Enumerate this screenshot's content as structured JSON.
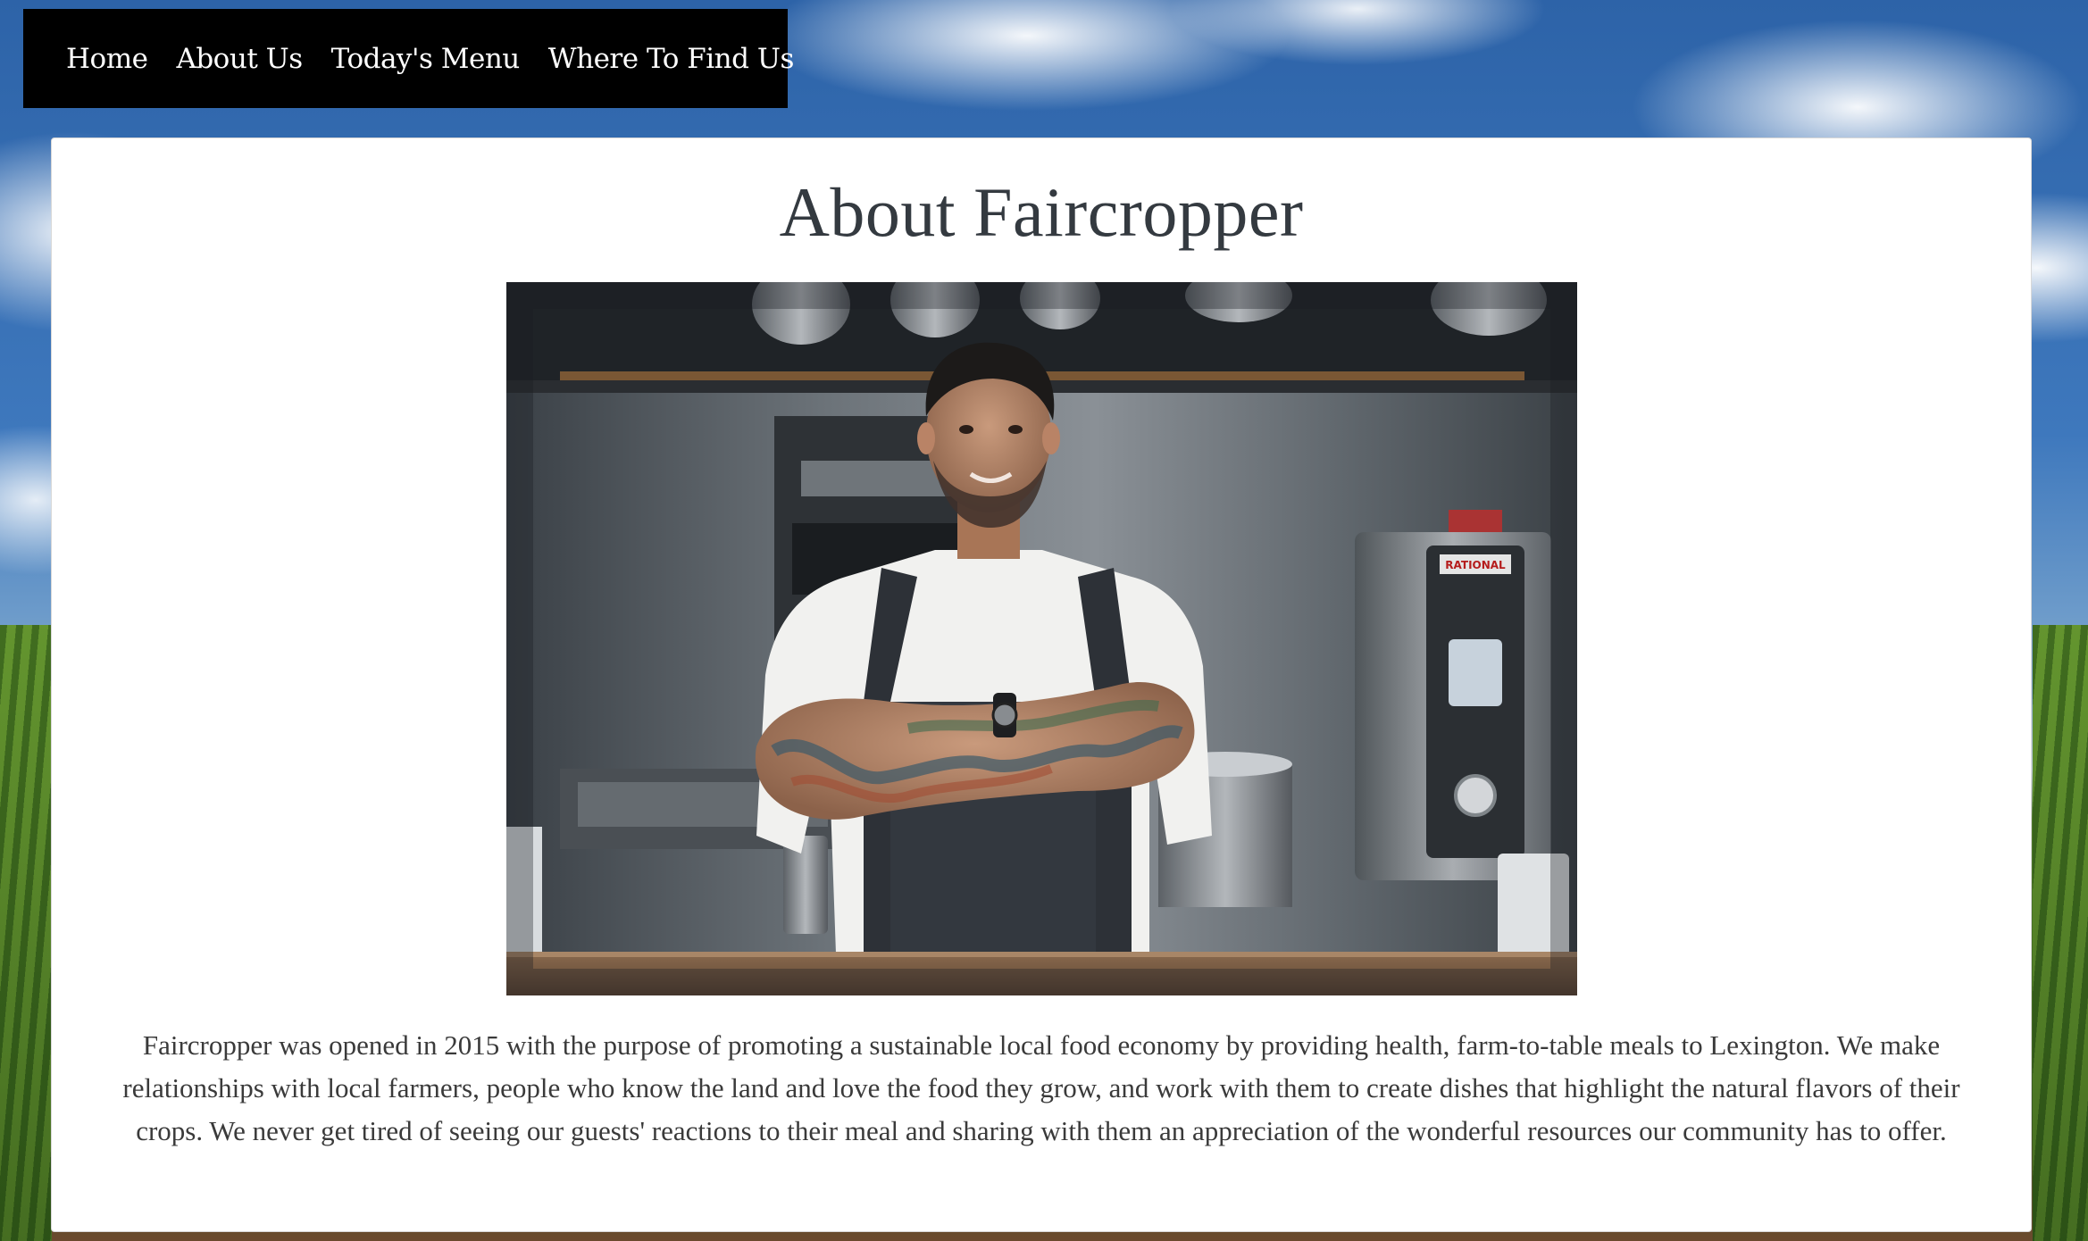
{
  "nav": {
    "items": [
      {
        "label": "Home"
      },
      {
        "label": "About Us"
      },
      {
        "label": "Today's Menu"
      },
      {
        "label": "Where To Find Us"
      }
    ]
  },
  "main": {
    "title": "About Faircropper",
    "photo": {
      "appliance_brand": "RATIONAL"
    },
    "description": "Faircropper was opened in 2015 with the purpose of promoting a sustainable local food economy by providing health, farm-to-table meals to Lexington. We make relationships with local farmers, people who know the land and love the food they grow, and work with them to create dishes that highlight the natural flavors of their crops. We never get tired of seeing our guests' reactions to their meal and sharing with them an appreciation of the wonderful resources our community has to offer."
  },
  "colors": {
    "nav_background": "#000000",
    "nav_text": "#ffffff",
    "card_background": "#ffffff",
    "title_text": "#343a40",
    "body_text": "#3a3a3a"
  }
}
